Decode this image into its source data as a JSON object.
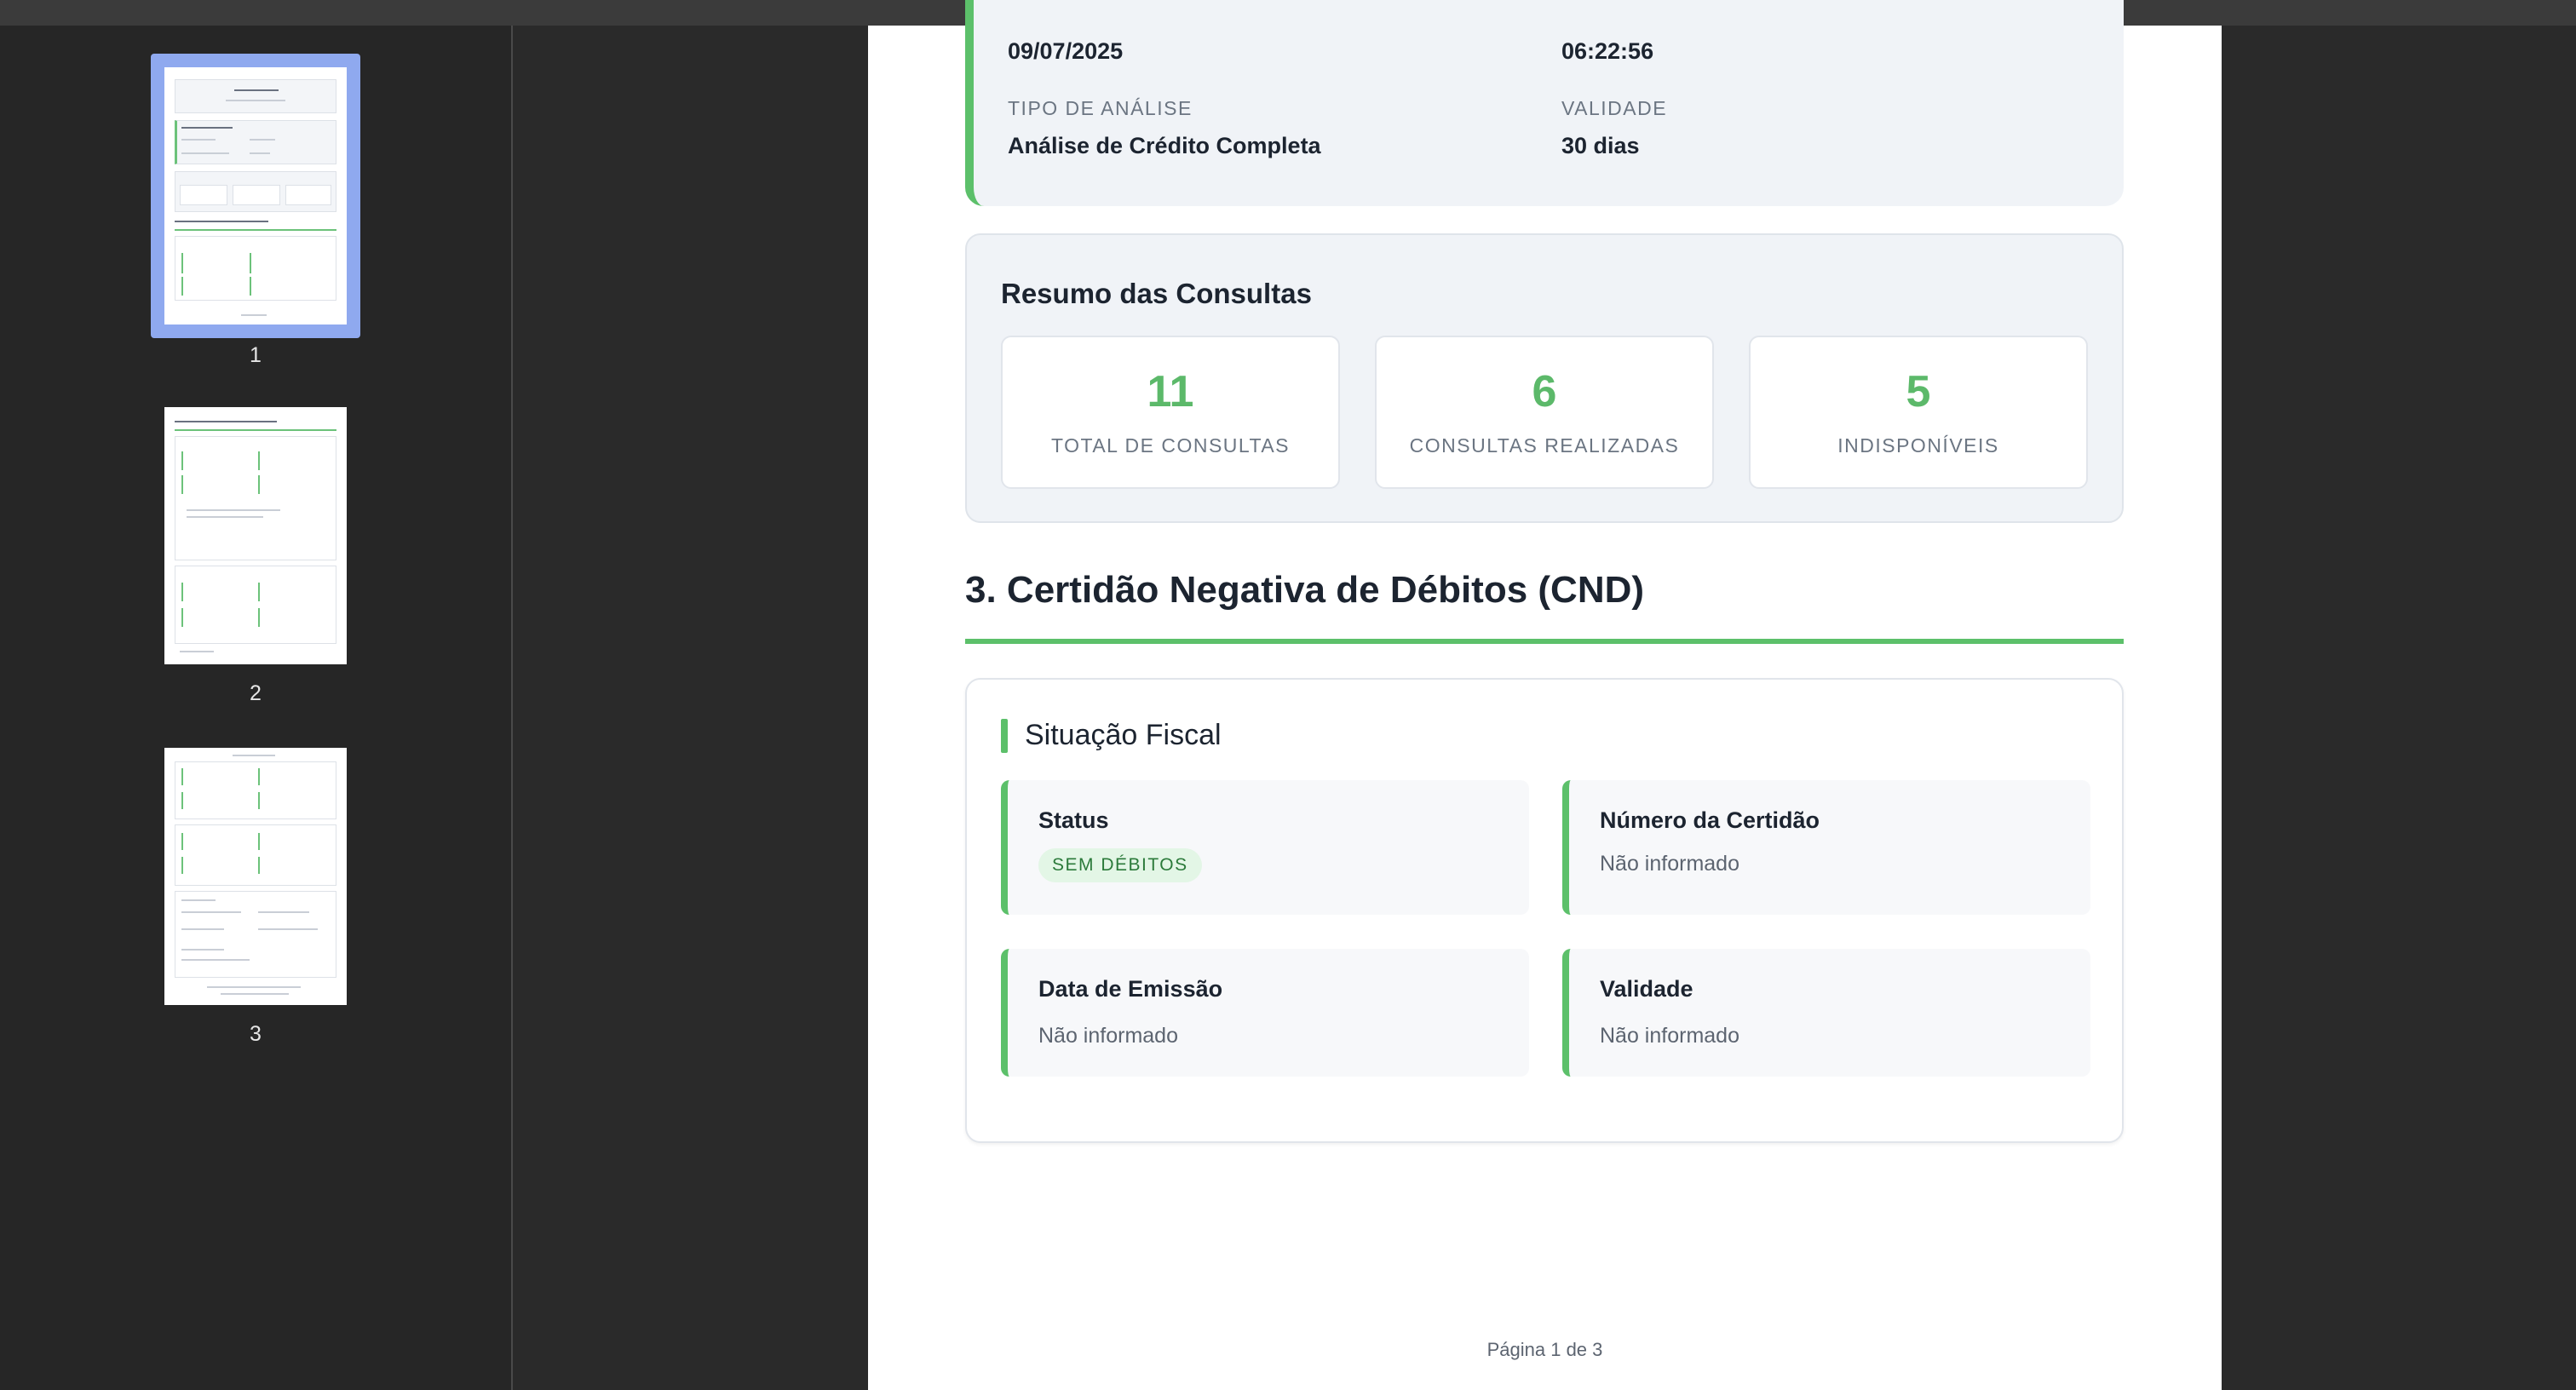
{
  "thumbnails": [
    {
      "label": "1",
      "selected": true
    },
    {
      "label": "2",
      "selected": false
    },
    {
      "label": "3",
      "selected": false
    }
  ],
  "document": {
    "info": {
      "date": "09/07/2025",
      "time": "06:22:56",
      "analysis_type_label": "TIPO DE ANÁLISE",
      "analysis_type_value": "Análise de Crédito Completa",
      "validity_label": "VALIDADE",
      "validity_value": "30 dias"
    },
    "summary": {
      "title": "Resumo das Consultas",
      "stats": [
        {
          "value": "11",
          "label": "TOTAL DE CONSULTAS"
        },
        {
          "value": "6",
          "label": "CONSULTAS REALIZADAS"
        },
        {
          "value": "5",
          "label": "INDISPONÍVEIS"
        }
      ]
    },
    "section": {
      "title": "3. Certidão Negativa de Débitos (CND)",
      "subsection_title": "Situação Fiscal",
      "fields": [
        {
          "label": "Status",
          "value": "SEM DÉBITOS"
        },
        {
          "label": "Número da Certidão",
          "value": "Não informado"
        },
        {
          "label": "Data de Emissão",
          "value": "Não informado"
        },
        {
          "label": "Validade",
          "value": "Não informado"
        }
      ]
    },
    "footer": "Página 1 de 3"
  },
  "colors": {
    "accent": "#5cc06a",
    "thumbnail_selection": "#8fa9ef",
    "viewer_background": "#2a2a2a"
  }
}
